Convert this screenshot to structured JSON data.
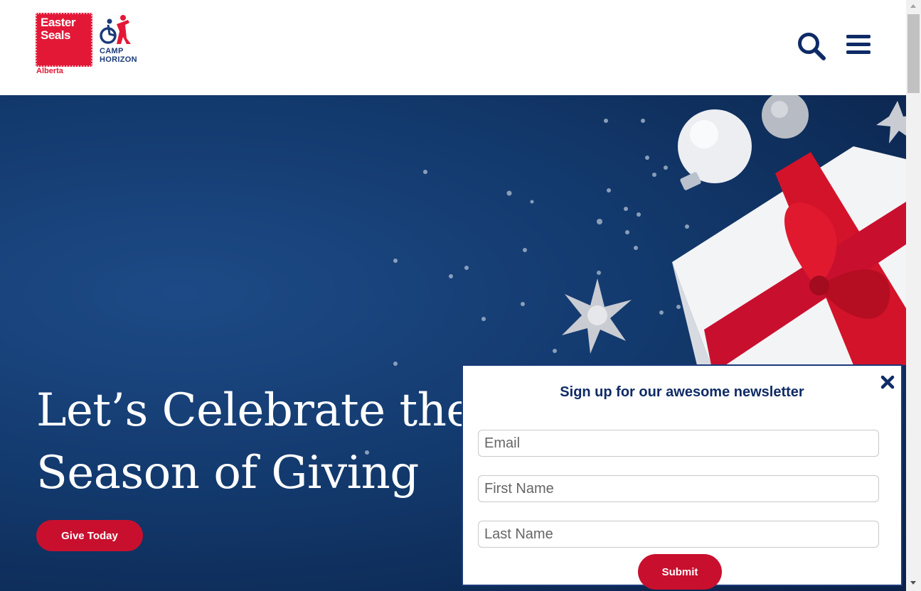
{
  "header": {
    "logo": {
      "line1": "Easter",
      "line2": "Seals",
      "region": "Alberta",
      "camp_line1": "CAMP",
      "camp_line2": "HORIZON"
    },
    "search_icon": "search-icon",
    "menu_icon": "hamburger-menu-icon"
  },
  "hero": {
    "title_line1": "Let’s Celebrate the",
    "title_line2": "Season of Giving",
    "cta_label": "Give Today"
  },
  "newsletter": {
    "title": "Sign up for our awesome newsletter",
    "email_placeholder": "Email",
    "first_name_placeholder": "First Name",
    "last_name_placeholder": "Last Name",
    "submit_label": "Submit",
    "close_icon": "close-icon"
  },
  "colors": {
    "brand_red": "#c8102e",
    "brand_navy": "#0f2b66",
    "hero_background": "#133a6e"
  }
}
